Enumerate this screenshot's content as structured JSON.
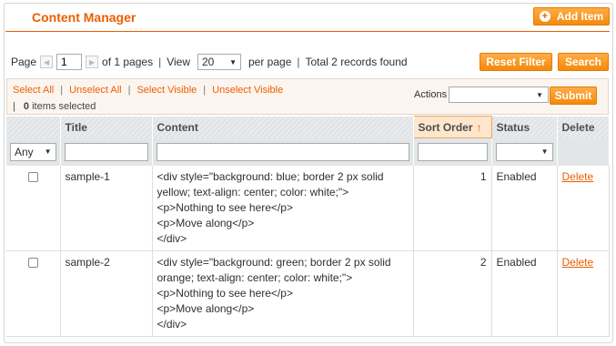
{
  "header": {
    "title": "Content Manager",
    "add_button": "Add Item",
    "add_icon": "plus-circle-icon"
  },
  "pager": {
    "page_label": "Page",
    "page_value": "1",
    "of_pages": "of 1 pages",
    "view_label": "View",
    "per_page_value": "20",
    "per_page_label": "per page",
    "total": "Total 2 records found"
  },
  "toolbar": {
    "reset_filter": "Reset Filter",
    "search": "Search"
  },
  "massaction": {
    "select_all": "Select All",
    "unselect_all": "Unselect All",
    "select_visible": "Select Visible",
    "unselect_visible": "Unselect Visible",
    "selected_count": "0",
    "selected_suffix": "items selected",
    "actions_label": "Actions",
    "submit": "Submit"
  },
  "grid": {
    "columns": [
      "",
      "Title",
      "Content",
      "Sort Order",
      "Status",
      "Delete"
    ],
    "filter": {
      "any": "Any"
    },
    "rows": [
      {
        "title": "sample-1",
        "content": [
          "<div style=\"background: blue; border 2 px solid",
          "yellow; text-align: center; color: white;\">",
          "<p>Nothing to see here</p>",
          "<p>Move along</p>",
          "</div>"
        ],
        "sort_order": "1",
        "status": "Enabled",
        "delete": "Delete"
      },
      {
        "title": "sample-2",
        "content": [
          "<div style=\"background: green; border 2 px solid",
          "orange; text-align: center; color: white;\">",
          "<p>Nothing to see here</p>",
          "<p>Move along</p>",
          "</div>"
        ],
        "sort_order": "2",
        "status": "Enabled",
        "delete": "Delete"
      }
    ]
  },
  "colors": {
    "accent": "#eb5e00",
    "button": "#f48a0b"
  }
}
